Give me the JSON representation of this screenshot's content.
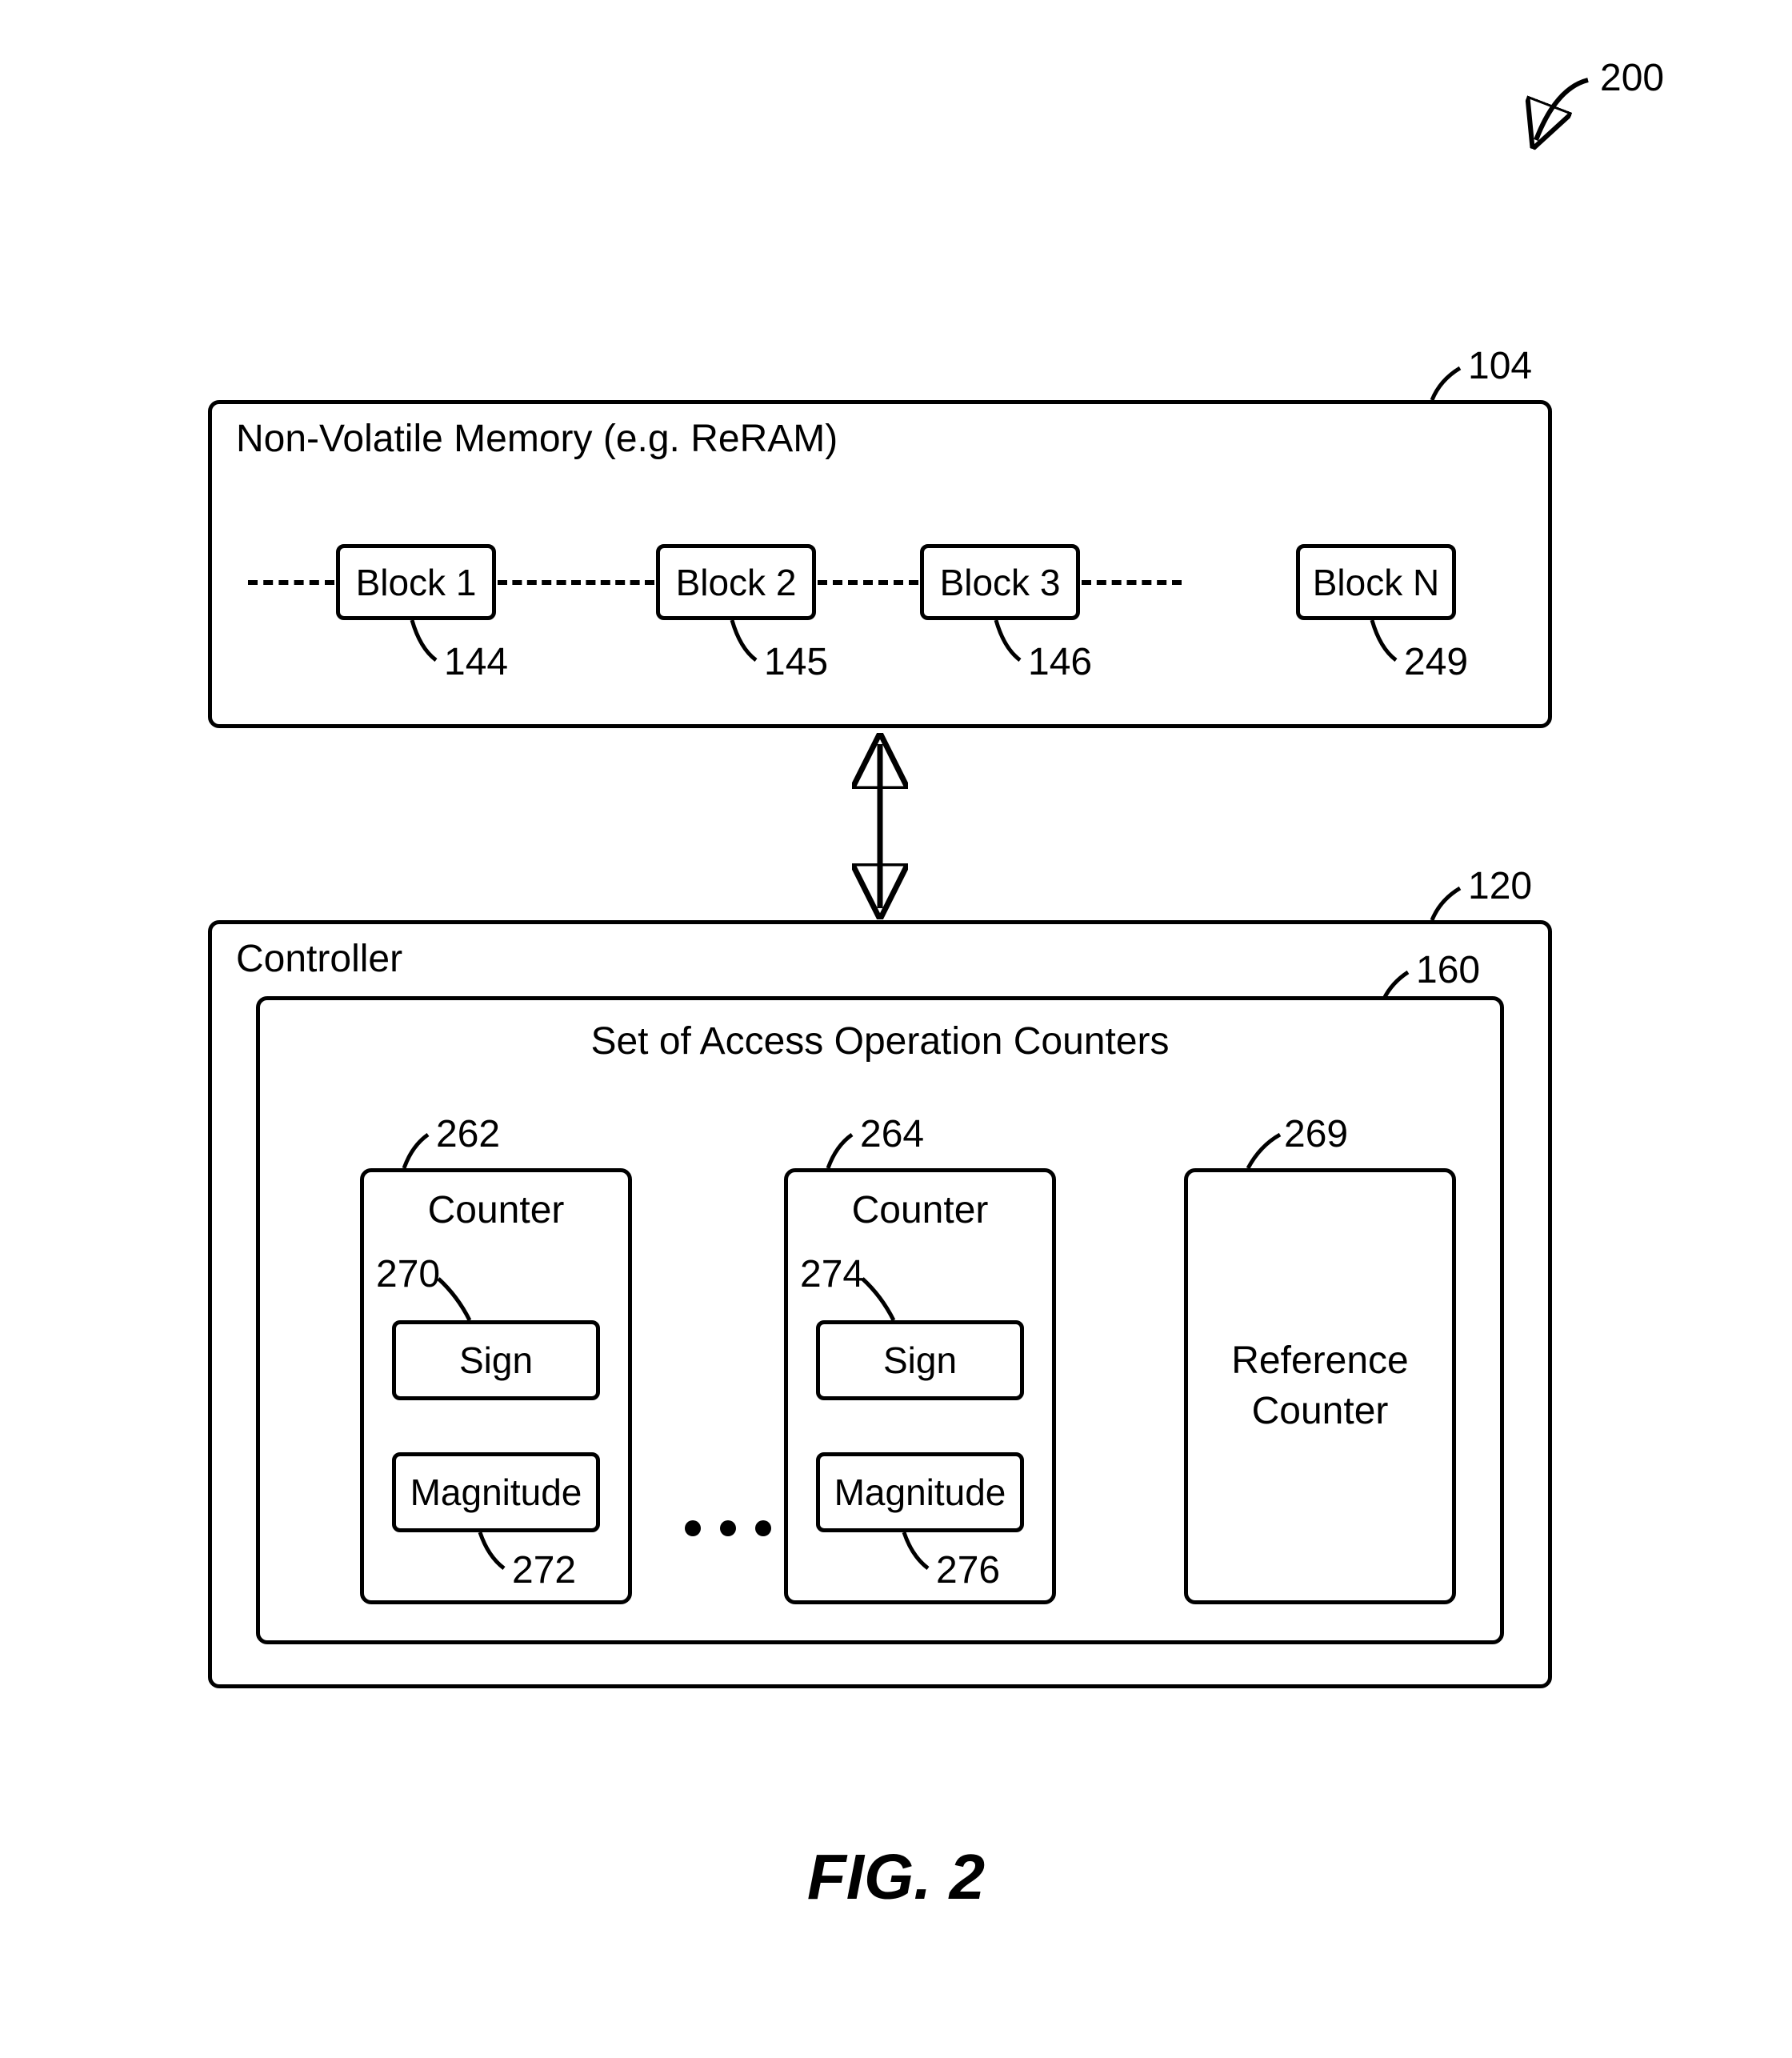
{
  "figure": {
    "overall_ref": "200",
    "caption": "FIG. 2"
  },
  "nvm": {
    "ref": "104",
    "title": "Non-Volatile Memory (e.g. ReRAM)",
    "blocks": [
      {
        "label": "Block 1",
        "ref": "144"
      },
      {
        "label": "Block 2",
        "ref": "145"
      },
      {
        "label": "Block 3",
        "ref": "146"
      },
      {
        "label": "Block N",
        "ref": "249"
      }
    ]
  },
  "controller": {
    "ref": "120",
    "title": "Controller",
    "counters_set": {
      "ref": "160",
      "title": "Set of Access Operation Counters",
      "counters": [
        {
          "ref": "262",
          "label": "Counter",
          "sign": {
            "label": "Sign",
            "ref": "270"
          },
          "magnitude": {
            "label": "Magnitude",
            "ref": "272"
          }
        },
        {
          "ref": "264",
          "label": "Counter",
          "sign": {
            "label": "Sign",
            "ref": "274"
          },
          "magnitude": {
            "label": "Magnitude",
            "ref": "276"
          }
        }
      ],
      "reference": {
        "ref": "269",
        "label": "Reference Counter"
      }
    }
  }
}
